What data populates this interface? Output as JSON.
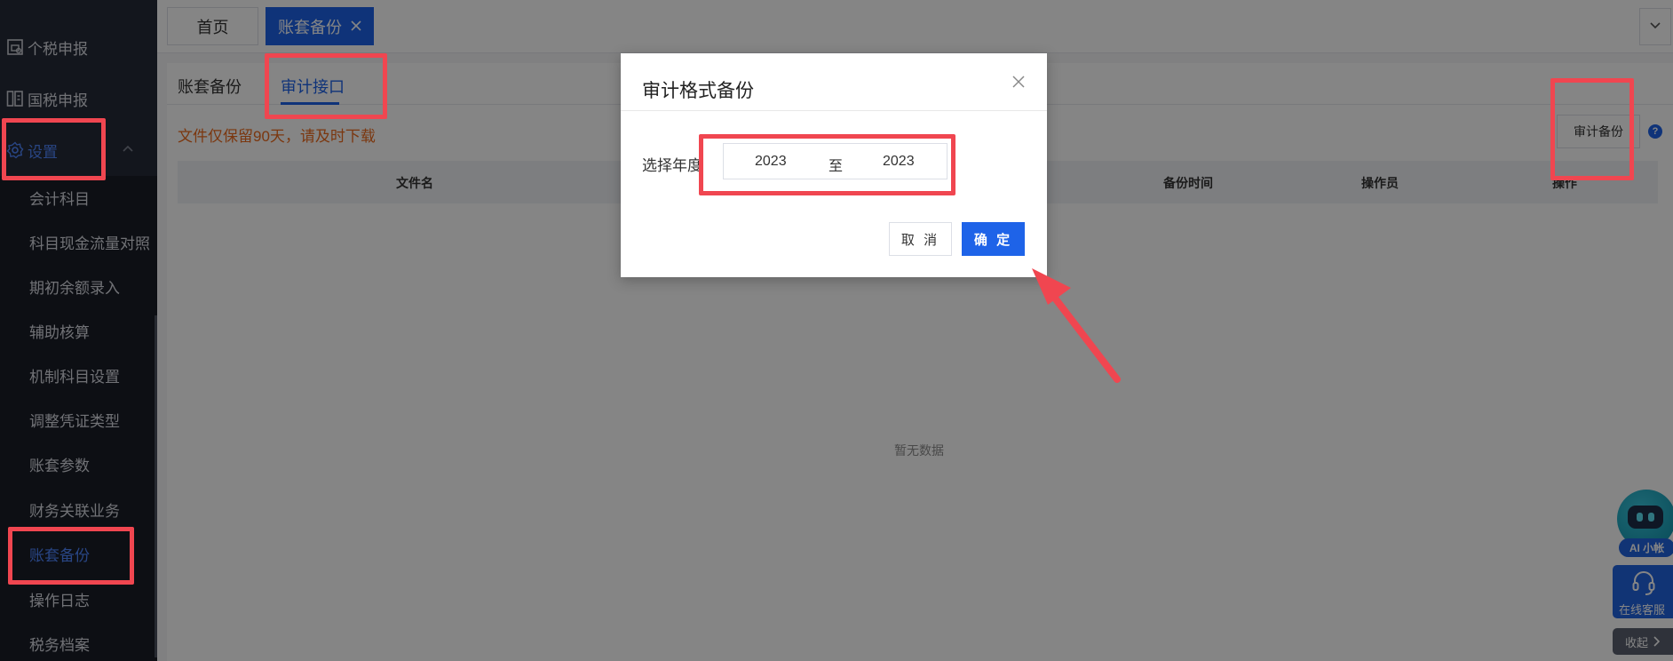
{
  "sidebar": {
    "items": [
      {
        "label": "个税申报",
        "icon": "report-icon"
      },
      {
        "label": "国税申报",
        "icon": "tax-icon"
      },
      {
        "label": "设置",
        "icon": "gear-icon"
      }
    ],
    "sub_items": [
      {
        "label": "会计科目"
      },
      {
        "label": "科目现金流量对照"
      },
      {
        "label": "期初余额录入"
      },
      {
        "label": "辅助核算"
      },
      {
        "label": "机制科目设置"
      },
      {
        "label": "调整凭证类型"
      },
      {
        "label": "账套参数"
      },
      {
        "label": "财务关联业务"
      },
      {
        "label": "账套备份"
      },
      {
        "label": "操作日志"
      },
      {
        "label": "税务档案"
      }
    ],
    "active_sub": "账套备份"
  },
  "page_tabs": [
    {
      "label": "首页"
    },
    {
      "label": "账套备份"
    }
  ],
  "content": {
    "tabs": [
      {
        "label": "账套备份"
      },
      {
        "label": "审计接口"
      }
    ],
    "notice": "文件仅保留90天，请及时下载",
    "audit_backup_button": "审计备份",
    "help_mark": "?",
    "table": {
      "columns": [
        "文件名",
        "备份时间",
        "操作员",
        "操作"
      ]
    },
    "empty_text": "暂无数据"
  },
  "widgets": {
    "ai_label": "AI 小帐",
    "service_label": "在线客服",
    "collapse_label": "收起"
  },
  "modal": {
    "title": "审计格式备份",
    "year_label": "选择年度",
    "start_year": "2023",
    "separator": "至",
    "end_year": "2023",
    "cancel_label": "取 消",
    "ok_label": "确 定"
  },
  "colors": {
    "primary": "#1e63e8",
    "sidebar_bg": "#1f2330",
    "notice": "#ec6a1e",
    "annotation": "#f04650"
  }
}
